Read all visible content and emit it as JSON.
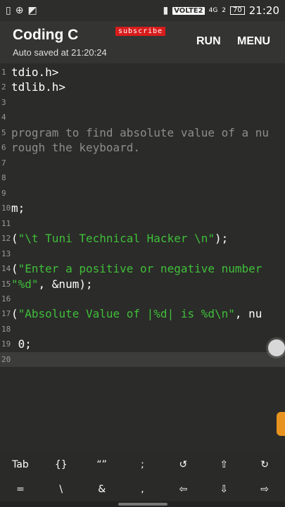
{
  "status": {
    "left_icons": [
      "notification-icon",
      "add-circle-icon",
      "cast-icon"
    ],
    "signal_label": "VOLTE2",
    "net_label": "4G",
    "net_sub": "2",
    "battery": "70",
    "time": "21:20"
  },
  "appbar": {
    "title": "Coding C",
    "subtitle": "Auto saved at 21:20:24",
    "subscribe": "subscribe",
    "run": "RUN",
    "menu": "MENU"
  },
  "editor": {
    "lines": [
      {
        "num": "1",
        "text": "tdio.h>"
      },
      {
        "num": "2",
        "text": "tdlib.h>"
      },
      {
        "num": "3",
        "text": ""
      },
      {
        "num": "4",
        "text": ""
      },
      {
        "num": "5",
        "text": "program to find absolute value of a nu"
      },
      {
        "num": "6",
        "text": "rough the keyboard."
      },
      {
        "num": "7",
        "text": ""
      },
      {
        "num": "8",
        "text": ""
      },
      {
        "num": "9",
        "text": ""
      },
      {
        "num": "10",
        "text": "m;"
      },
      {
        "num": "11",
        "text": ""
      },
      {
        "num": "12",
        "text_a": "(",
        "text_b": "\"\\t Tuni Technical Hacker \\n\"",
        "text_c": ");"
      },
      {
        "num": "13",
        "text": ""
      },
      {
        "num": "14",
        "text_a": "(",
        "text_b": "\"Enter a positive or negative number"
      },
      {
        "num": "15",
        "text_b": "\"%d\"",
        "text_c": ", &num);"
      },
      {
        "num": "16",
        "text": ""
      },
      {
        "num": "17",
        "text_a": "(",
        "text_b": "\"Absolute Value of |%d| is %d\\n\"",
        "text_c": ", nu"
      },
      {
        "num": "18",
        "text": ""
      },
      {
        "num": "19",
        "text": " 0;"
      },
      {
        "num": "20",
        "text": ""
      }
    ]
  },
  "keys": {
    "row1": [
      "Tab",
      "{}",
      "“”",
      ";",
      "↺",
      "⇧",
      "↻"
    ],
    "row2": [
      "=",
      "\\",
      "&",
      ",",
      "⇦",
      "⇩",
      "⇨"
    ]
  }
}
